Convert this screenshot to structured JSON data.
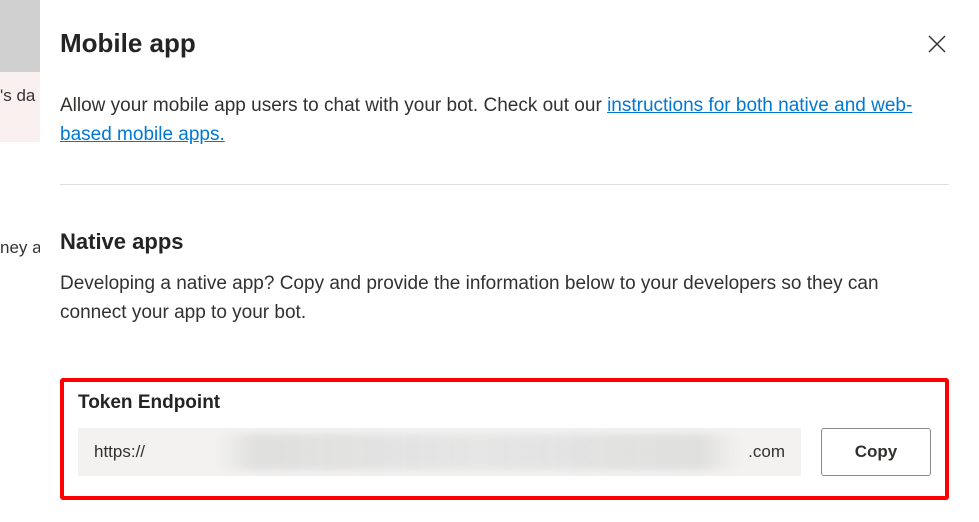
{
  "bg": {
    "text1": "'s da",
    "text2": "ney a"
  },
  "panel": {
    "title": "Mobile app",
    "description_prefix": "Allow your mobile app users to chat with your bot. Check out our ",
    "description_link": "instructions for both native and web-based mobile apps.",
    "native_title": "Native apps",
    "native_desc": "Developing a native app? Copy and provide the information below to your developers so they can connect your app to your bot.",
    "token_label": "Token Endpoint",
    "token_value_prefix": "https://",
    "token_value_suffix": ".com",
    "copy_label": "Copy"
  }
}
